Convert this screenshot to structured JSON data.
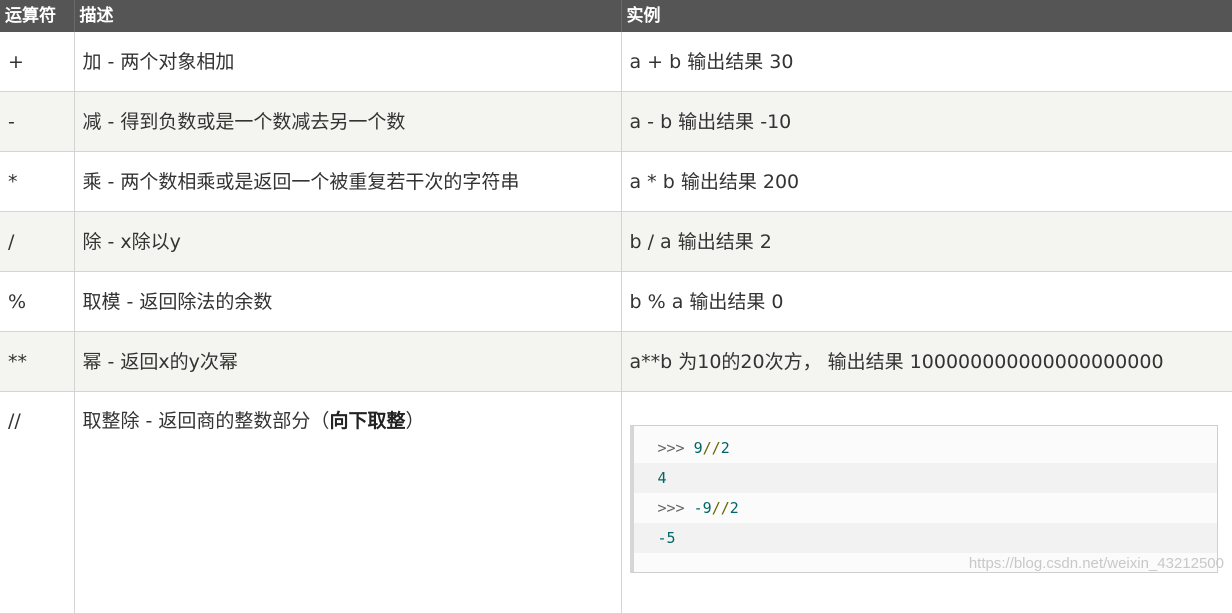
{
  "header": {
    "col_operator": "运算符",
    "col_description": "描述",
    "col_example": "实例"
  },
  "rows": [
    {
      "op": "+",
      "desc": "加 - 两个对象相加",
      "example": "a + b 输出结果 30"
    },
    {
      "op": "-",
      "desc": "减 - 得到负数或是一个数减去另一个数",
      "example": "a - b 输出结果 -10"
    },
    {
      "op": "*",
      "desc": "乘 - 两个数相乘或是返回一个被重复若干次的字符串",
      "example": "a * b 输出结果 200"
    },
    {
      "op": "/",
      "desc": "除 - x除以y",
      "example": "b / a 输出结果 2"
    },
    {
      "op": "%",
      "desc": "取模 - 返回除法的余数",
      "example": "b % a 输出结果 0"
    },
    {
      "op": "**",
      "desc": "幂 - 返回x的y次幂",
      "example": "a**b 为10的20次方， 输出结果 100000000000000000000"
    },
    {
      "op": "//",
      "desc": "取整除 - 返回商的整数部分（",
      "desc_bold": "向下取整",
      "desc_end": "）"
    }
  ],
  "code_block": {
    "line1_prompt": ">>>",
    "line1_num1": "9",
    "line1_op": "//",
    "line1_num2": "2",
    "line2_out": "4",
    "line3_prompt": ">>>",
    "line3_num1": "-9",
    "line3_op": "//",
    "line3_num2": "2",
    "line4_out": "-5"
  },
  "watermark": "https://blog.csdn.net/weixin_43212500",
  "colors": {
    "header_bg": "#555555",
    "alt_row_bg": "#f4f4f1",
    "border": "#d4d4d4"
  }
}
